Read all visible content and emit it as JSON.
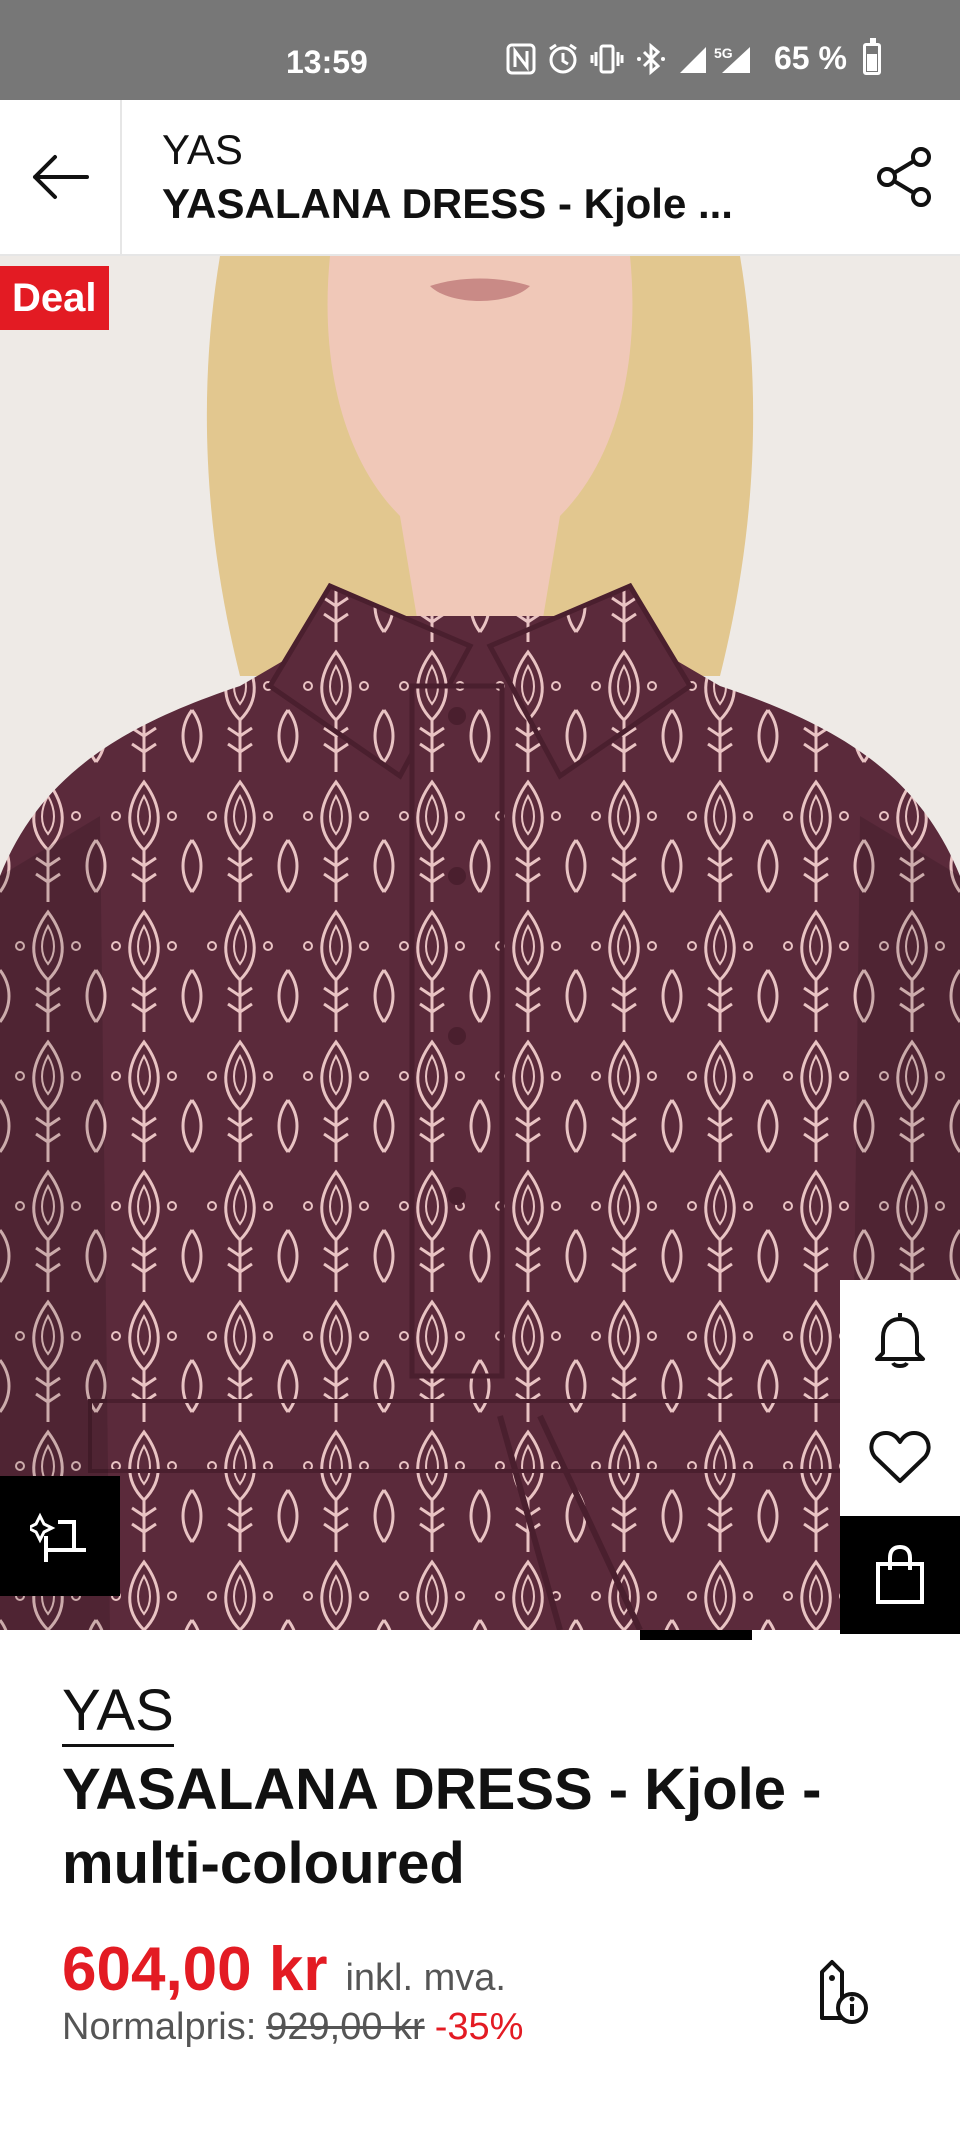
{
  "status_bar": {
    "time": "13:59",
    "battery": "65 %",
    "icons": [
      "nfc-icon",
      "alarm-icon",
      "vibrate-icon",
      "bluetooth-icon",
      "signal-icon",
      "5g-signal-icon",
      "battery-icon"
    ],
    "network_label": "5G"
  },
  "header": {
    "brand": "YAS",
    "product": "YASALANA DRESS - Kjole ..."
  },
  "image": {
    "badge": "Deal",
    "colors": {
      "fabric": "#5b2a3b",
      "print": "#e9c3c3",
      "skin": "#f0c8b8",
      "hair": "#e2c78f"
    }
  },
  "product": {
    "brand": "YAS",
    "name": "YASALANA DRESS - Kjole - multi-coloured",
    "price": "604,00 kr",
    "price_note": "inkl. mva.",
    "normal_label": "Normalpris:",
    "normal_price": "929,00 kr",
    "discount": "-35%"
  },
  "colors": {
    "accent": "#e31b23",
    "text": "#111111",
    "muted": "#555555"
  }
}
